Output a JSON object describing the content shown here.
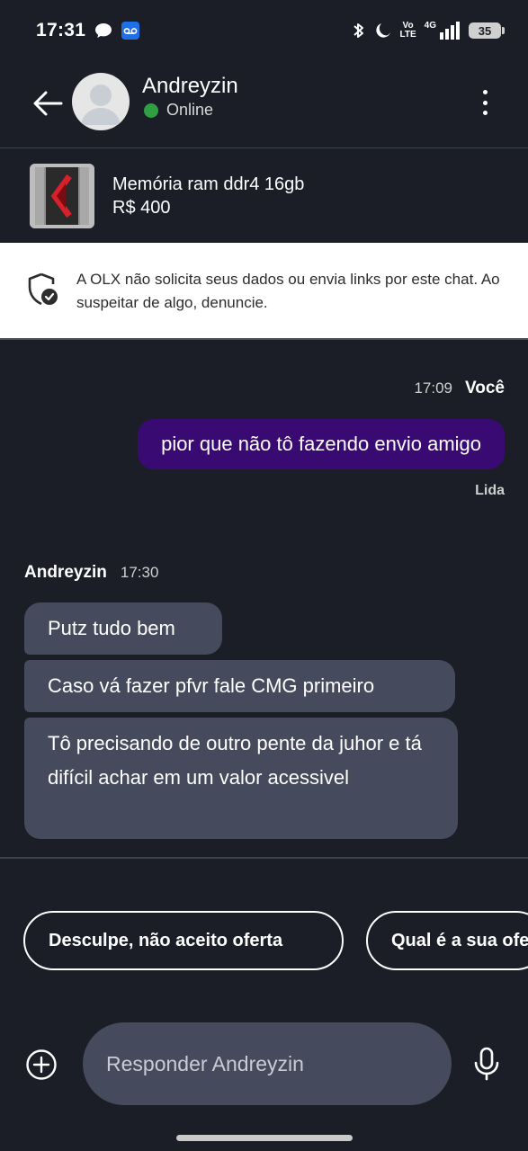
{
  "status_bar": {
    "time": "17:31",
    "volte_line1": "Vo",
    "volte_line2": "LTE",
    "network": "4G",
    "battery": "35"
  },
  "header": {
    "contact_name": "Andreyzin",
    "presence": "Online"
  },
  "product": {
    "title": "Memória ram ddr4 16gb",
    "price": "R$ 400"
  },
  "warning": {
    "text": "A OLX não solicita seus dados ou envia links por este chat. Ao suspeitar de algo, denuncie."
  },
  "messages": {
    "outgoing": {
      "time": "17:09",
      "sender": "Você",
      "text": "pior que não tô fazendo envio amigo",
      "status": "Lida"
    },
    "incoming": {
      "sender": "Andreyzin",
      "time": "17:30",
      "bubbles": [
        "Putz tudo bem",
        "Caso vá fazer pfvr fale CMG primeiro",
        "Tô precisando de outro pente da juhor e tá difícil achar em um valor acessivel"
      ]
    }
  },
  "quick_replies": [
    "Desculpe, não aceito oferta",
    "Qual é a sua oferta?"
  ],
  "composer": {
    "placeholder": "Responder Andreyzin"
  },
  "colors": {
    "background": "#1b1e27",
    "outgoing_bubble": "#3a0a73",
    "incoming_bubble": "#454b5c",
    "online": "#2ea043"
  }
}
